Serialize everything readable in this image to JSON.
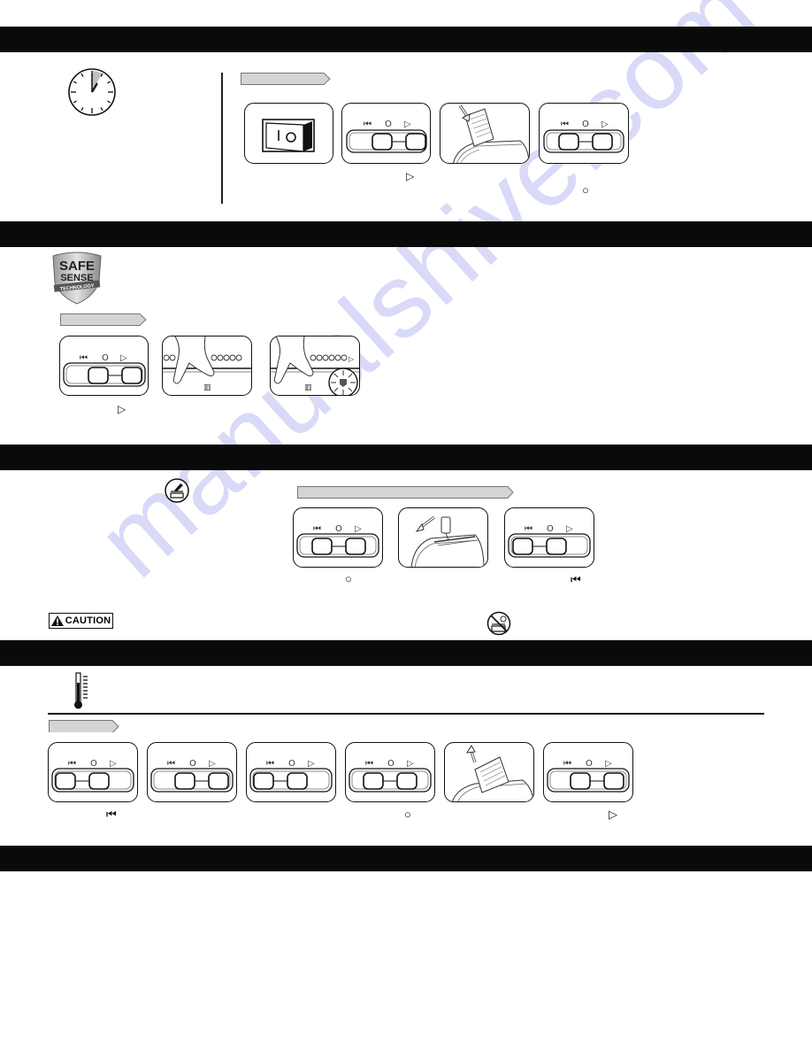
{
  "page": {
    "background": "#ffffff",
    "header_bar_color": "#0a0a0a",
    "arrow_fill": "#d4d4d4",
    "watermark": {
      "text": "manualshive.com",
      "color": "#8080e6"
    }
  },
  "switch_labels": {
    "reverse": "⏮",
    "off": "O",
    "forward": "▷"
  },
  "sections": [
    {
      "id": "operation",
      "icon": "clock-icon",
      "steps": [
        {
          "name": "power-switch-on",
          "caption_symbol": ""
        },
        {
          "name": "switch-auto-forward",
          "caption_symbol": "▷"
        },
        {
          "name": "insert-paper",
          "caption_symbol": ""
        },
        {
          "name": "switch-off",
          "caption_symbol": "○"
        }
      ]
    },
    {
      "id": "safesense",
      "logo": {
        "line1": "SAFE",
        "line2": "SENSE",
        "line3": "TECHNOLOGY"
      },
      "steps": [
        {
          "name": "switch-auto-forward",
          "caption_symbol": "▷"
        },
        {
          "name": "hands-near-opening",
          "caption_symbol": ""
        },
        {
          "name": "safesense-indicator-lit",
          "caption_symbol": ""
        }
      ]
    },
    {
      "id": "oiling",
      "icon": "oil-icon",
      "steps": [
        {
          "name": "switch-off",
          "caption_symbol": "○"
        },
        {
          "name": "apply-oil",
          "caption_symbol": ""
        },
        {
          "name": "switch-reverse",
          "caption_symbol": "⏮"
        }
      ],
      "caution_label": "CAUTION",
      "no_aerosol_icon": "no-aerosol-icon"
    },
    {
      "id": "overheat",
      "icon": "thermometer-icon",
      "steps": [
        {
          "name": "switch-reverse",
          "caption_symbol": "⏮"
        },
        {
          "name": "switch-forward",
          "caption_symbol": ""
        },
        {
          "name": "switch-reverse-2",
          "caption_symbol": ""
        },
        {
          "name": "switch-off",
          "caption_symbol": "○"
        },
        {
          "name": "remove-paper",
          "caption_symbol": ""
        },
        {
          "name": "switch-auto-forward",
          "caption_symbol": "▷"
        }
      ]
    },
    {
      "id": "footer-section"
    }
  ]
}
